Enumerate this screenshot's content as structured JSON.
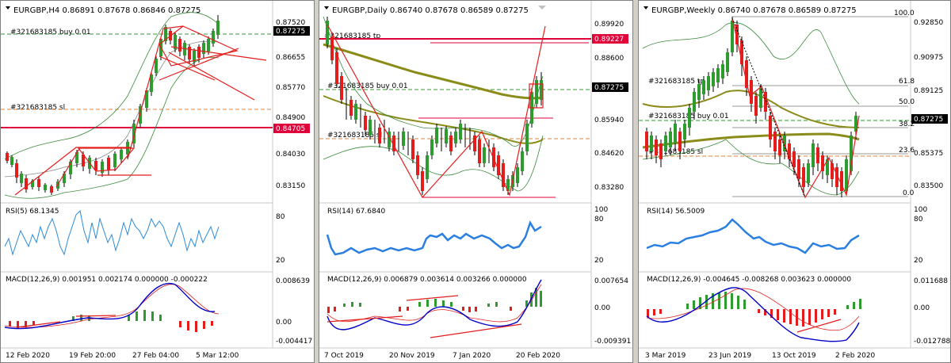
{
  "charts": [
    {
      "id": "h4",
      "header": "EURGBP,H4  0.86891 0.87678 0.86846 0.87275",
      "symbol": "EURGBP",
      "timeframe": "H4",
      "ohlc": {
        "open": 0.86891,
        "high": 0.87678,
        "low": 0.86846,
        "close": 0.87275
      },
      "price_ticks": [
        "0.87520",
        "0.86655",
        "0.85770",
        "0.84900",
        "0.84030",
        "0.83150"
      ],
      "price_range": [
        0.826,
        0.883
      ],
      "current_price": "0.87275",
      "lines": [
        {
          "label": "#321683185 buy 0.01",
          "price": 0.8727
        },
        {
          "label": "#321683185 sl",
          "price": 0.8503
        },
        {
          "label": "",
          "price": 0.84705,
          "tag": "0.84705"
        }
      ],
      "rsi": {
        "label": "RSI(5) 68.1345",
        "ticks": [
          "80",
          "20"
        ]
      },
      "macd": {
        "label": "MACD(12,26,9) 0.001951 0.002174 0.000000 -0.000222",
        "ticks": [
          "0.008639",
          "0.00",
          "-0.004417"
        ]
      },
      "dates": [
        "12 Feb 2020",
        "19 Feb 20:00",
        "27 Feb 04:00",
        "5 Mar 12:00"
      ]
    },
    {
      "id": "daily",
      "header": "EURGBP,Daily  0.86740 0.87678 0.86589 0.87275",
      "symbol": "EURGBP",
      "timeframe": "Daily",
      "ohlc": {
        "open": 0.8674,
        "high": 0.87678,
        "low": 0.86589,
        "close": 0.87275
      },
      "price_ticks": [
        "0.89920",
        "0.88600",
        "0.87260",
        "0.85940",
        "0.84620",
        "0.83280"
      ],
      "price_range": [
        0.8268,
        0.9051
      ],
      "current_price": "0.87275",
      "lines": [
        {
          "label": "#321683185 tp",
          "price": 0.8922,
          "tag": "0.89227"
        },
        {
          "label": "#321683185 buy 0.01",
          "price": 0.8727
        },
        {
          "label": "#321683185 sl",
          "price": 0.8503
        }
      ],
      "rsi": {
        "label": "RSI(14) 67.6840",
        "ticks": [
          "100",
          "80",
          "20"
        ]
      },
      "macd": {
        "label": "MACD(12,26,9) 0.006879 0.003614 0.003266 0.000000",
        "ticks": [
          "0.007654",
          "0.00",
          "-0.009391"
        ]
      },
      "dates": [
        "7 Oct 2019",
        "20 Nov 2019",
        "7 Jan 2020",
        "20 Feb 2020"
      ]
    },
    {
      "id": "weekly",
      "header": "EURGBP,Weekly  0.86740 0.87678 0.86589 0.87275",
      "symbol": "EURGBP",
      "timeframe": "Weekly",
      "ohlc": {
        "open": 0.8674,
        "high": 0.87678,
        "low": 0.86589,
        "close": 0.87275
      },
      "price_ticks": [
        "0.92850",
        "0.90975",
        "0.89125",
        "0.87250",
        "0.85375",
        "0.83500"
      ],
      "price_range": [
        0.8275,
        0.9336
      ],
      "current_price": "0.87275",
      "lines": [
        {
          "label": "#321683185 tp",
          "price": 0.8922
        },
        {
          "label": "#321683185 buy 0.01",
          "price": 0.8727
        },
        {
          "label": "#321683185 sl",
          "price": 0.8503
        }
      ],
      "fibo": [
        "100.0",
        "61.8",
        "50.0",
        "38.2",
        "23.6",
        "0.0"
      ],
      "rsi": {
        "label": "RSI(14) 56.5009",
        "ticks": [
          "100",
          "80",
          "20"
        ]
      },
      "macd": {
        "label": "MACD(12,26,9) -0.004645 -0.008268 0.003623 0.000000",
        "ticks": [
          "0.011688",
          "0.00",
          "-0.012788"
        ]
      },
      "dates": [
        "3 Mar 2019",
        "23 Jun 2019",
        "13 Oct 2019",
        "2 Feb 2020"
      ]
    }
  ],
  "colors": {
    "bull": "#2e9b2e",
    "bear": "#e31c1c",
    "ma": "#8b8b1a",
    "band": "#3a8a3a",
    "rsi_h4": "#2a8ad8",
    "rsi": "#2a7fe0",
    "macd_main": "#0000c8",
    "macd_signal": "#e02020",
    "hline": "#e0003a"
  }
}
